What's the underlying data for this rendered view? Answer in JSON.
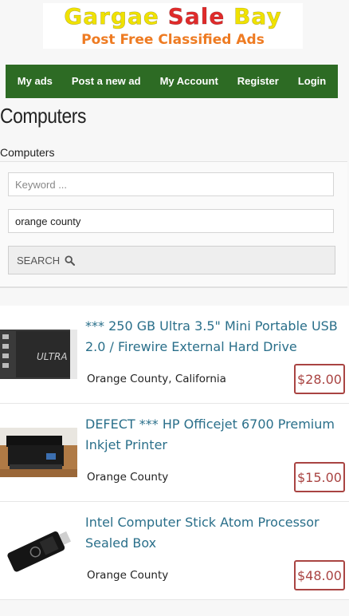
{
  "logo": {
    "word1": "Gargae",
    "word2": "Sale",
    "word3": "Bay",
    "tagline": "Post Free Classified Ads"
  },
  "nav": {
    "items": [
      "My ads",
      "Post a new ad",
      "My Account",
      "Register",
      "Login"
    ]
  },
  "page": {
    "title": "Computers",
    "breadcrumb": "Computers"
  },
  "search": {
    "keyword_placeholder": "Keyword ...",
    "location_value": "orange county",
    "button_label": "SEARCH"
  },
  "listings": [
    {
      "title": "*** 250 GB Ultra 3.5\" Mini Portable USB 2.0 / Firewire External Hard Drive",
      "location": "Orange County, California",
      "price": "$28.00"
    },
    {
      "title": "DEFECT *** HP Officejet 6700 Premium Inkjet Printer",
      "location": "Orange County",
      "price": "$15.00"
    },
    {
      "title": "Intel Computer Stick Atom Processor Sealed Box",
      "location": "Orange County",
      "price": "$48.00"
    }
  ],
  "colors": {
    "nav_bg": "#2d6b24",
    "link": "#2a6f8a",
    "price": "#a94442",
    "logo_yellow": "#f0e200",
    "logo_red": "#e02a2a",
    "logo_orange": "#ee7b22"
  }
}
